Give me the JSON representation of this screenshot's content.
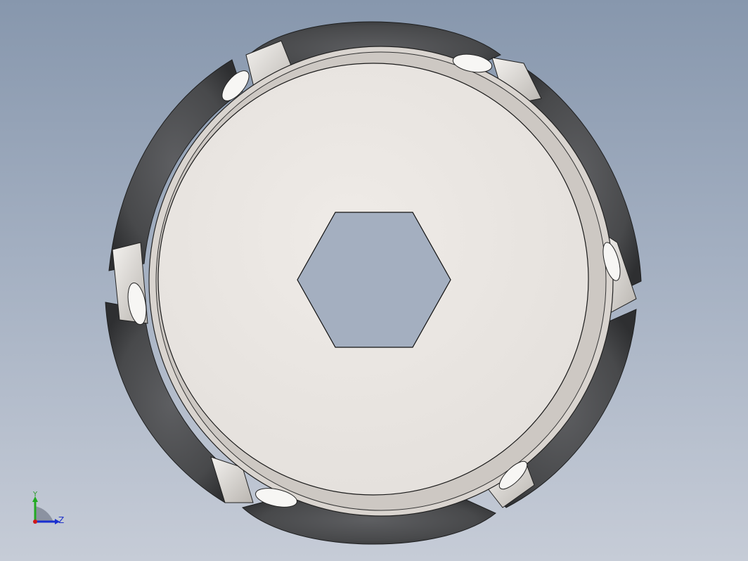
{
  "viewport": {
    "background_top": "#8797ad",
    "background_bottom": "#c6ccd7"
  },
  "model": {
    "roller_color": "#4a4b4d",
    "hub_color": "#ebe7e3",
    "rim_color": "#d9d4cf",
    "hex_hole_color": "#a4afc0",
    "roller_count": 6
  },
  "triad": {
    "axis_y_label": "Y",
    "axis_z_label": "Z",
    "axis_y_color": "#22aa22",
    "axis_z_color": "#1a2fd0",
    "origin_color": "#d01818"
  }
}
